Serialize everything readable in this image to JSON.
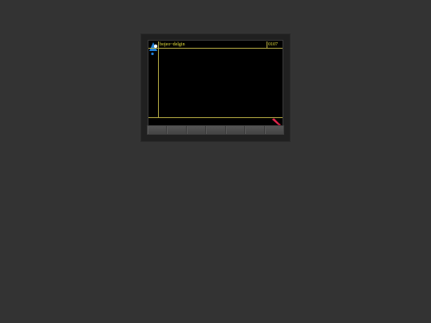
{
  "screen": {
    "title": "bojeo~delgin",
    "count": "0107"
  },
  "icons": {
    "logo": "brand-logo-icon",
    "phone": "phone-handset-icon"
  },
  "colors": {
    "accent_text": "#e8e23a",
    "divider": "#b8ad44",
    "logo_blue": "#1e7fd8",
    "phone_red": "#e0244a"
  },
  "softkeys": [
    "",
    "",
    "",
    "",
    "",
    "",
    ""
  ]
}
